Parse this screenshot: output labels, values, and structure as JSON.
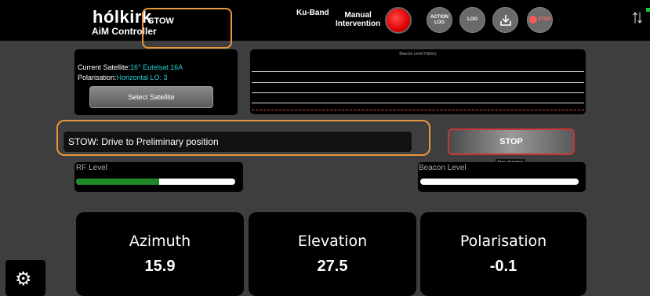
{
  "header": {
    "brand": "hólkirk",
    "subbrand": "AiM Controller",
    "mode": "STOW",
    "band": "Ku-Band",
    "manual_line1": "Manual",
    "manual_line2": "Intervention",
    "action_log_label1": "ACTION",
    "action_log_label2": "LOG",
    "log_label": "LOG",
    "stop_icon_label": "STOP"
  },
  "satellite": {
    "current_label": "Current Satellite:",
    "current_value": "16° Eutelsat 16A",
    "polarisation_label": "Polarisation:",
    "polarisation_value": "Horizontal LO: 3",
    "select_button": "Select Satellite"
  },
  "beacon_history": {
    "title": "Beacon Level History"
  },
  "status": {
    "message": "STOW: Drive to Preliminary position",
    "stop_button": "STOP",
    "stop_tooltip": "Stop all motion"
  },
  "levels": {
    "rf_label": "RF Level",
    "rf_fraction": 0.52,
    "beacon_label": "Beacon Level",
    "beacon_fraction": 0.0
  },
  "readouts": [
    {
      "label": "Azimuth",
      "value": "15.9"
    },
    {
      "label": "Elevation",
      "value": "27.5"
    },
    {
      "label": "Polarisation",
      "value": "-0.1"
    }
  ],
  "colors": {
    "accent_orange": "#e8973a",
    "cyan_text": "#23d0d6",
    "rf_bar": "#1f8a2a",
    "stop_border": "#c23838"
  }
}
